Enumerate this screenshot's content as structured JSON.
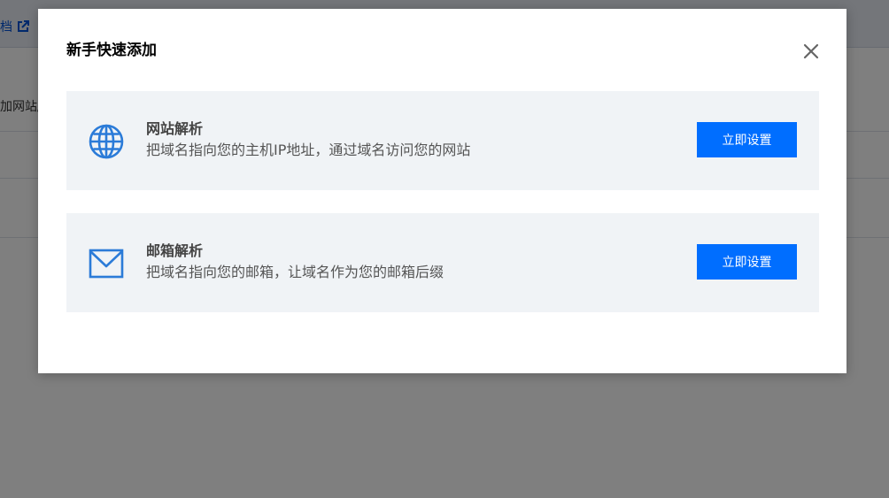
{
  "background": {
    "doc_link_text": "档",
    "add_site_text": "加网站/"
  },
  "dialog": {
    "title": "新手快速添加",
    "close_icon": "close-icon",
    "cards": [
      {
        "icon": "globe-icon",
        "title": "网站解析",
        "description": "把域名指向您的主机IP地址，通过域名访问您的网站",
        "button_label": "立即设置"
      },
      {
        "icon": "mail-icon",
        "title": "邮箱解析",
        "description": "把域名指向您的邮箱，让域名作为您的邮箱后缀",
        "button_label": "立即设置"
      }
    ]
  },
  "colors": {
    "primary": "#006eff",
    "card_background": "#f0f3f6",
    "icon_blue": "#2b7bd8",
    "mask": "rgba(0,0,0,0.5)"
  }
}
